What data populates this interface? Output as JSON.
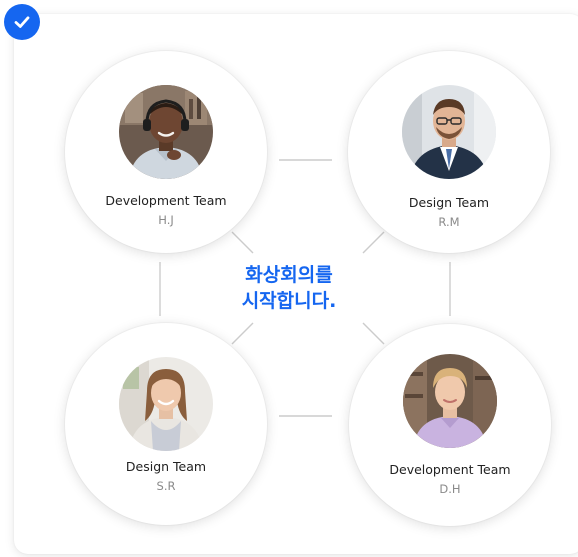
{
  "center_heading": {
    "line1": "화상회의를",
    "line2": "시작합니다."
  },
  "participants": [
    {
      "team": "Development Team",
      "initials": "H.J"
    },
    {
      "team": "Design Team",
      "initials": "R.M"
    },
    {
      "team": "Design Team",
      "initials": "S.R"
    },
    {
      "team": "Development Team",
      "initials": "D.H"
    }
  ],
  "colors": {
    "accent": "#1566f0",
    "connector": "#cccccc"
  },
  "icons": {
    "badge": "checkmark-icon"
  }
}
